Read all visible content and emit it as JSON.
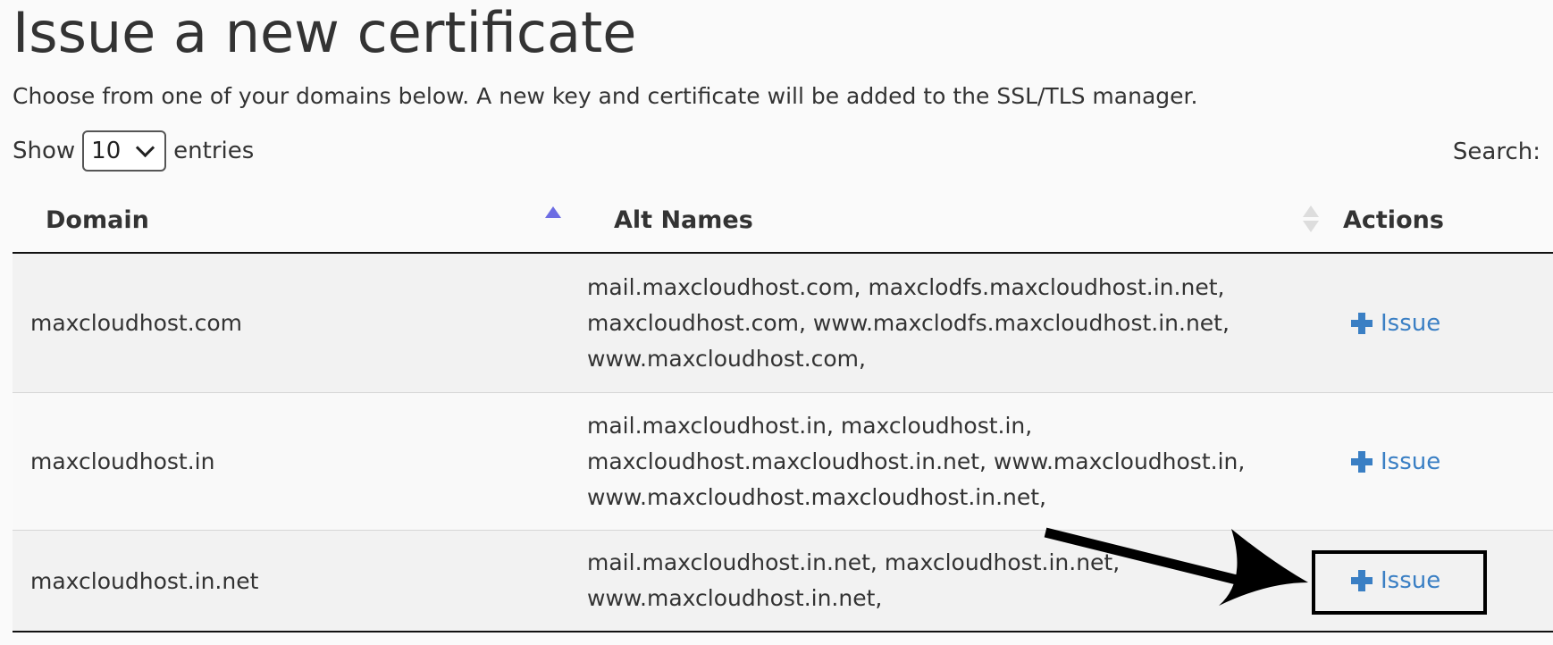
{
  "page": {
    "title": "Issue a new certificate",
    "description": "Choose from one of your domains below. A new key and certificate will be added to the SSL/TLS manager."
  },
  "length_control": {
    "show_label": "Show",
    "selected_value": "10",
    "entries_label": "entries"
  },
  "search": {
    "label": "Search:"
  },
  "table": {
    "columns": [
      "Domain",
      "Alt Names",
      "Actions"
    ],
    "sorted_column": "Domain",
    "sort_direction": "ascending",
    "rows": [
      {
        "domain": "maxcloudhost.com",
        "alt_names": [
          "mail.maxcloudhost.com, maxclodfs.maxcloudhost.in.net,",
          "maxcloudhost.com, www.maxclodfs.maxcloudhost.in.net,",
          "www.maxcloudhost.com,"
        ],
        "action": "Issue"
      },
      {
        "domain": "maxcloudhost.in",
        "alt_names": [
          "mail.maxcloudhost.in, maxcloudhost.in,",
          "maxcloudhost.maxcloudhost.in.net, www.maxcloudhost.in,",
          "www.maxcloudhost.maxcloudhost.in.net,"
        ],
        "action": "Issue"
      },
      {
        "domain": "maxcloudhost.in.net",
        "alt_names": [
          "mail.maxcloudhost.in.net, maxcloudhost.in.net,",
          "www.maxcloudhost.in.net,"
        ],
        "action": "Issue"
      }
    ]
  },
  "annotation": {
    "target_row": "maxcloudhost.in.net",
    "color": "#000000"
  },
  "colors": {
    "link": "#3a7fc4",
    "sort_active": "#6d6de3",
    "sort_inactive": "#dddddd",
    "row_odd": "#f2f2f2",
    "row_even": "#f9f9f9",
    "text": "#333333"
  }
}
